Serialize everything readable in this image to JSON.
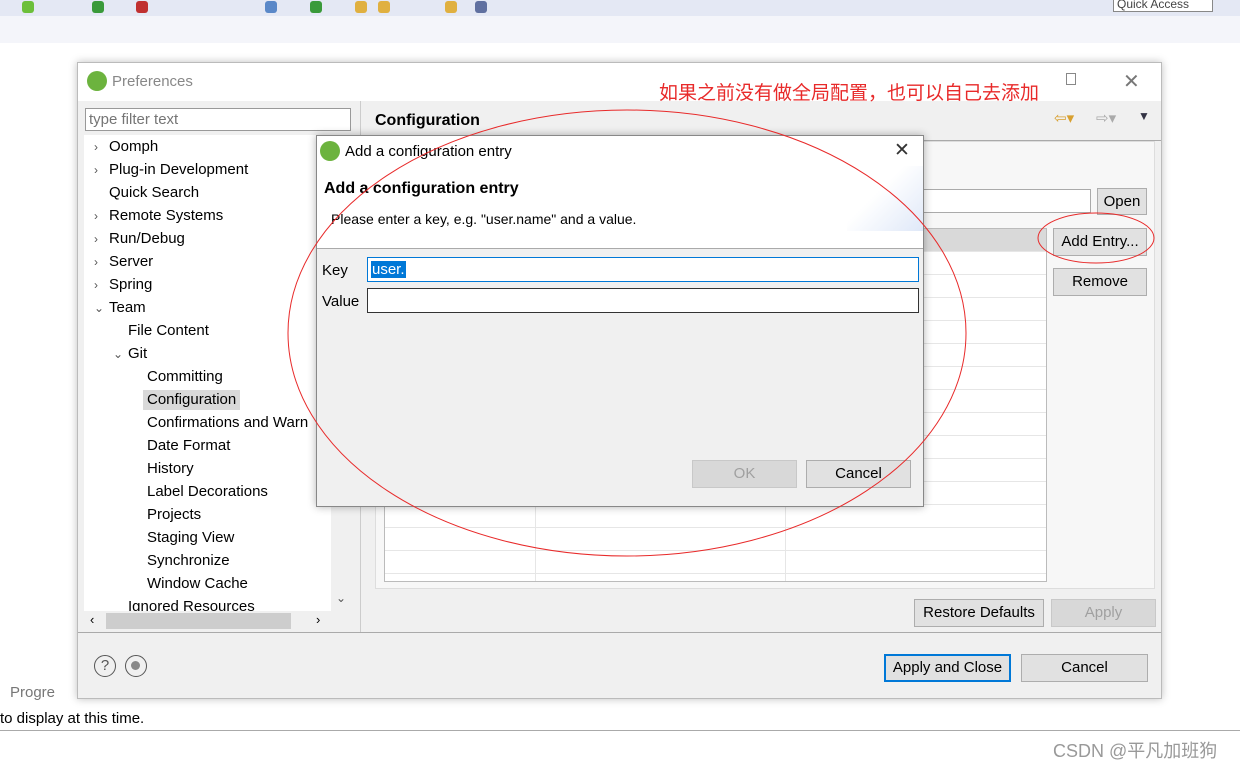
{
  "ide": {
    "quick_access": "Quick Access",
    "status_text": "to display at this time.",
    "progress_tab": "Progre"
  },
  "preferences": {
    "title": "Preferences",
    "filter_placeholder": "type filter text",
    "tree": [
      {
        "label": "Oomph",
        "level": 0,
        "expander": "collapsed"
      },
      {
        "label": "Plug-in Development",
        "level": 0,
        "expander": "collapsed"
      },
      {
        "label": "Quick Search",
        "level": 0,
        "expander": "none"
      },
      {
        "label": "Remote Systems",
        "level": 0,
        "expander": "collapsed"
      },
      {
        "label": "Run/Debug",
        "level": 0,
        "expander": "collapsed"
      },
      {
        "label": "Server",
        "level": 0,
        "expander": "collapsed"
      },
      {
        "label": "Spring",
        "level": 0,
        "expander": "collapsed"
      },
      {
        "label": "Team",
        "level": 0,
        "expander": "expanded"
      },
      {
        "label": "File Content",
        "level": 1,
        "expander": "none"
      },
      {
        "label": "Git",
        "level": 1,
        "expander": "expanded"
      },
      {
        "label": "Committing",
        "level": 2,
        "expander": "none"
      },
      {
        "label": "Configuration",
        "level": 2,
        "expander": "none",
        "selected": true
      },
      {
        "label": "Confirmations and Warn",
        "level": 2,
        "expander": "none"
      },
      {
        "label": "Date Format",
        "level": 2,
        "expander": "none"
      },
      {
        "label": "History",
        "level": 2,
        "expander": "none"
      },
      {
        "label": "Label Decorations",
        "level": 2,
        "expander": "none"
      },
      {
        "label": "Projects",
        "level": 2,
        "expander": "none"
      },
      {
        "label": "Staging View",
        "level": 2,
        "expander": "none"
      },
      {
        "label": "Synchronize",
        "level": 2,
        "expander": "none"
      },
      {
        "label": "Window Cache",
        "level": 2,
        "expander": "none"
      },
      {
        "label": "Ignored Resources",
        "level": 1,
        "expander": "none"
      }
    ],
    "page_title": "Configuration",
    "buttons": {
      "open": "Open",
      "add_entry": "Add Entry...",
      "remove": "Remove",
      "restore_defaults": "Restore Defaults",
      "apply": "Apply",
      "apply_and_close": "Apply and Close",
      "cancel": "Cancel"
    }
  },
  "entry_dialog": {
    "title": "Add a configuration entry",
    "heading": "Add a configuration entry",
    "message": "Please enter a key, e.g. \"user.name\" and a value.",
    "key_label": "Key",
    "key_value": "user.",
    "value_label": "Value",
    "value_value": "",
    "ok": "OK",
    "cancel": "Cancel"
  },
  "annotation": {
    "text": "如果之前没有做全局配置，也可以自己去添加",
    "color": "#e82a2a"
  },
  "watermark": "CSDN @平凡加班狗"
}
